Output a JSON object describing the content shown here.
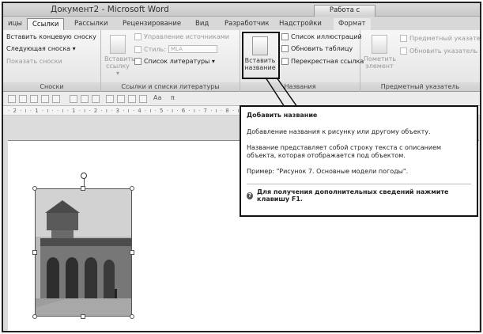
{
  "window": {
    "title": "Документ2 - Microsoft Word",
    "context_tab_header": "Работа с рисунками"
  },
  "tabs": [
    {
      "label": "ицы"
    },
    {
      "label": "Ссылки"
    },
    {
      "label": "Рассылки"
    },
    {
      "label": "Рецензирование"
    },
    {
      "label": "Вид"
    },
    {
      "label": "Разработчик"
    },
    {
      "label": "Надстройки"
    },
    {
      "label": "Формат"
    }
  ],
  "ribbon": {
    "footnotes": {
      "insert_endnote": "Вставить концевую сноску",
      "next_footnote": "Следующая сноска ▾",
      "show_notes": "Показать сноски",
      "group_label": "Сноски"
    },
    "citations": {
      "insert_citation": "Вставить ссылку ▾",
      "manage_sources": "Управление источниками",
      "style_label": "Стиль:",
      "style_value": "MLA",
      "bibliography": "Список литературы ▾",
      "group_label": "Ссылки и списки литературы"
    },
    "captions": {
      "insert_caption": "Вставить название",
      "insert_table_of_figures": "Список иллюстраций",
      "update_table": "Обновить таблицу",
      "cross_reference": "Перекрестная ссылка",
      "group_label": "Названия"
    },
    "index": {
      "mark_entry": "Пометить элемент",
      "insert_index": "Предметный указатель",
      "update_index": "Обновить указатель",
      "group_label": "Предметный указатель"
    }
  },
  "toolbar": {
    "font_size_label": "Aa",
    "pi_label": "π"
  },
  "ruler": {
    "marks": "· 2 · ı · 1 · ı · · ı · 1 · ı · 2 · ı · 3 · ı · 4 · ı · 5 · ı · 6 · ı · 7 · ı · 8 · ı"
  },
  "tooltip": {
    "title": "Добавить название",
    "line1": "Добавление названия к рисунку или другому объекту.",
    "line2": "Название представляет собой строку текста с описанием объекта, которая отображается под объектом.",
    "line3": "Пример: \"Рисунок 7. Основные модели погоды\".",
    "help": "Для получения дополнительных сведений нажмите клавишу F1."
  }
}
